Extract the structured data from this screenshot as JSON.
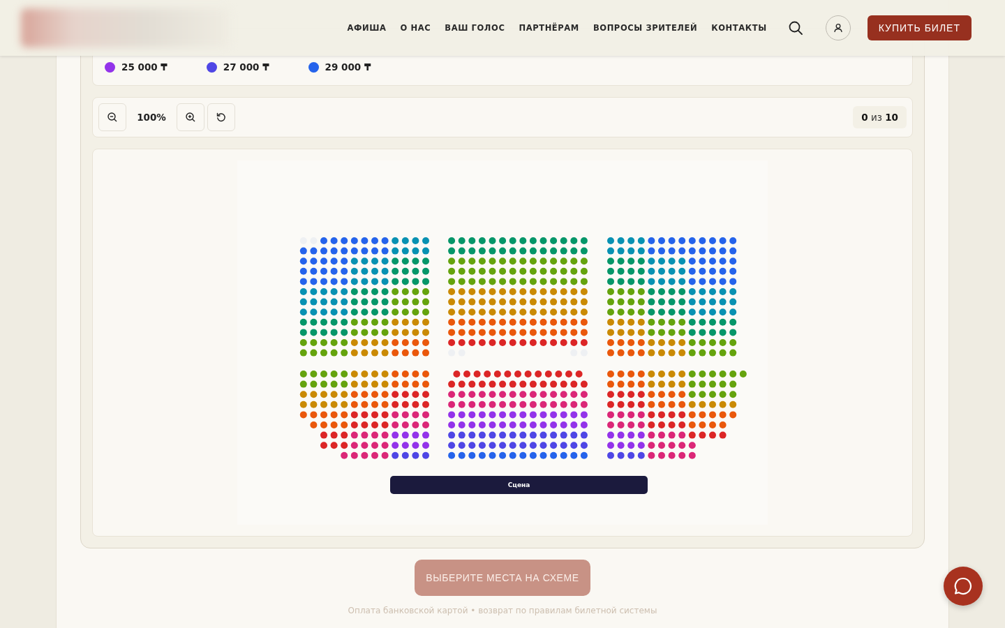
{
  "header": {
    "nav": [
      "АФИША",
      "О НАС",
      "ВАШ ГОЛОС",
      "ПАРТНЁРАМ",
      "ВОПРОСЫ ЗРИТЕЛЕЙ",
      "КОНТАКТЫ"
    ],
    "buy_button": "КУПИТЬ БИЛЕТ"
  },
  "legend": [
    {
      "price": "25 000 ₸",
      "color": "#9333ea"
    },
    {
      "price": "27 000 ₸",
      "color": "#4f46e5"
    },
    {
      "price": "29 000 ₸",
      "color": "#2563eb"
    }
  ],
  "toolbar": {
    "zoom": "100%",
    "counter": "**0** из **10**"
  },
  "seat_map": {
    "stage": "Сцена"
  },
  "submit_button": "ВЫБЕРИТЕ МЕСТА НА СХЕМЕ",
  "footnote": "Оплата банковской картой • возврат по правилам билетной системы"
}
